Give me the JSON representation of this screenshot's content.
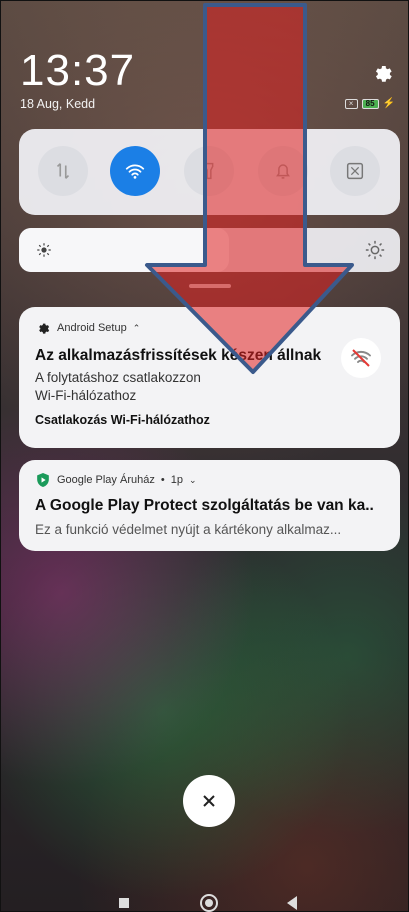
{
  "status": {
    "time": "13:37",
    "date": "18 Aug, Kedd",
    "battery": "85"
  },
  "notifications": [
    {
      "app": "Android Setup",
      "title": "Az alkalmazásfrissítések készen állnak",
      "text_line1": "A folytatáshoz csatlakozzon",
      "text_line2": "Wi-Fi-hálózathoz",
      "action": "Csatlakozás Wi-Fi-hálózathoz",
      "icon": "wifi-off-icon"
    },
    {
      "app": "Google Play Áruház",
      "time": "1p",
      "title": "A Google Play Protect szolgáltatás be van ka..",
      "text": "Ez a funkció védelmet nyújt a kártékony alkalmaz..."
    }
  ],
  "quick_settings": [
    {
      "name": "data-toggle",
      "icon": "mobile-data-icon",
      "active": false
    },
    {
      "name": "wifi-toggle",
      "icon": "wifi-icon",
      "active": true
    },
    {
      "name": "flashlight-toggle",
      "icon": "flashlight-icon",
      "active": false
    },
    {
      "name": "sound-toggle",
      "icon": "bell-icon",
      "active": false
    },
    {
      "name": "screenshot-toggle",
      "icon": "screenshot-icon",
      "active": false
    }
  ],
  "brightness": {
    "level": 0.55
  },
  "colors": {
    "accent": "#1b7fe6",
    "battery": "#4caf50",
    "arrow_fill": "#e02020",
    "arrow_stroke": "#3b5a8c"
  }
}
